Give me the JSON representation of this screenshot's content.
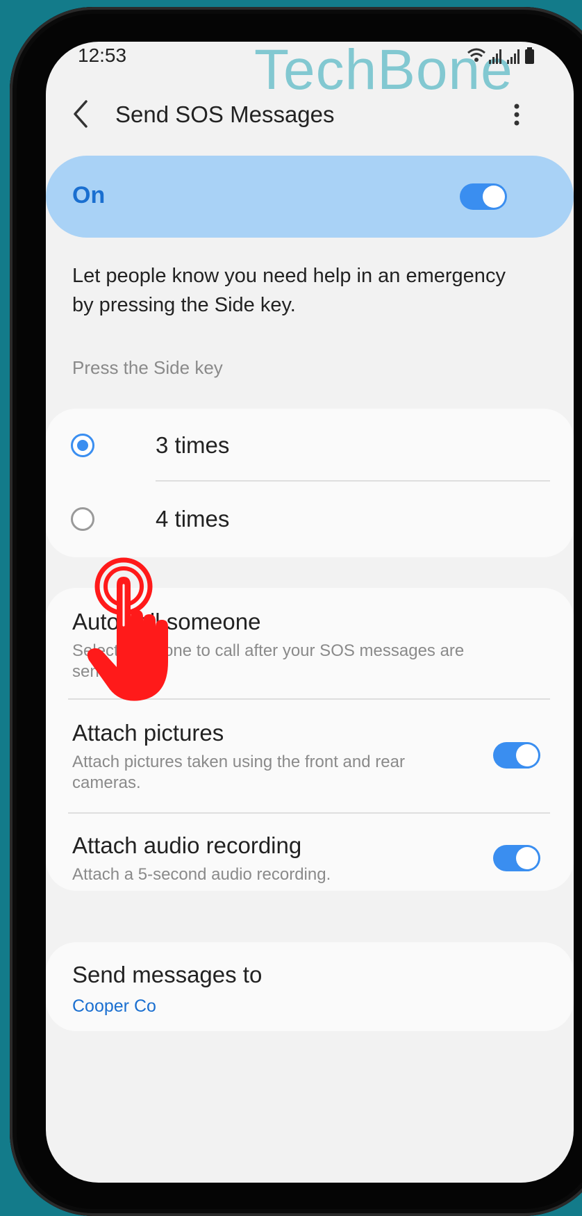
{
  "status_bar": {
    "time": "12:53"
  },
  "watermark": "TechBone",
  "app_bar": {
    "title": "Send SOS Messages"
  },
  "master_switch": {
    "label": "On",
    "on": true
  },
  "description": "Let people know you need help in an emergency by pressing the Side key.",
  "press_section": {
    "label": "Press the Side key",
    "options": [
      {
        "label": "3 times",
        "selected": true
      },
      {
        "label": "4 times",
        "selected": false
      }
    ]
  },
  "settings": {
    "auto_call": {
      "title": "Auto call someone",
      "subtitle": "Select someone to call after your SOS messages are sent."
    },
    "attach_pictures": {
      "title": "Attach pictures",
      "subtitle": "Attach pictures taken using the front and rear cameras.",
      "on": true
    },
    "attach_audio": {
      "title": "Attach audio recording",
      "subtitle": "Attach a 5-second audio recording.",
      "on": true
    }
  },
  "send_to": {
    "title": "Send messages to",
    "value": "Cooper Co"
  },
  "colors": {
    "accent": "#3a8ef0",
    "link": "#1a6fd0",
    "master_bg": "#a9d2f6",
    "watermark": "#7cc6cf",
    "hand": "#ff1a1a"
  }
}
